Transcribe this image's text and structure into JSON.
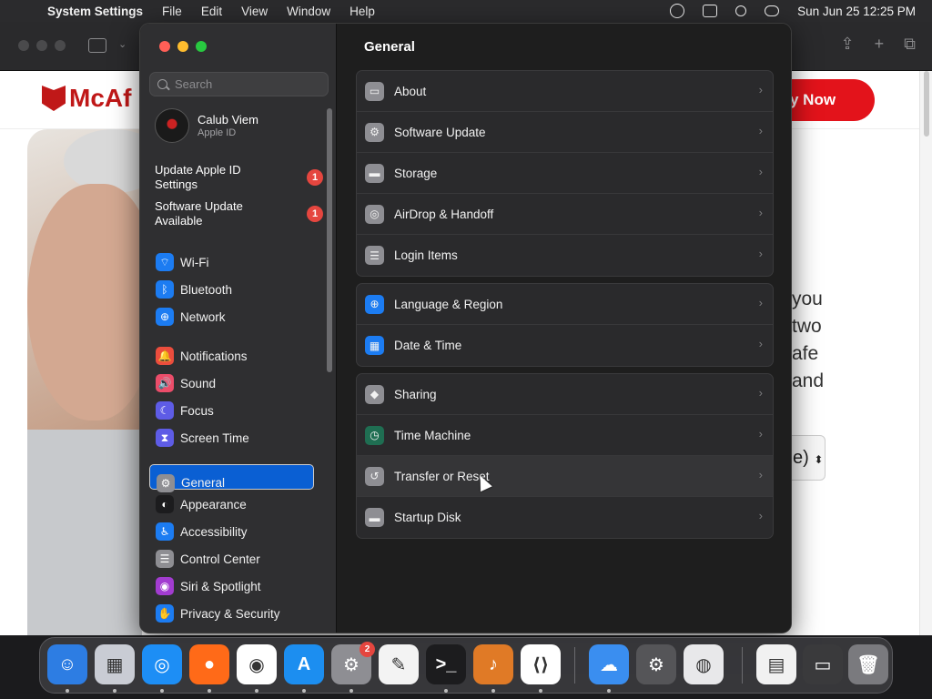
{
  "menubar": {
    "app": "System Settings",
    "menus": [
      "File",
      "Edit",
      "View",
      "Window",
      "Help"
    ],
    "clock": "Sun Jun 25  12:25 PM",
    "status_icons": [
      "screen-time-icon",
      "screen-mirroring-icon",
      "spotlight-icon",
      "control-center-icon"
    ]
  },
  "browser": {
    "logo": "McAf",
    "buy_button": "y Now",
    "text_lines": [
      "you",
      "two",
      "afe",
      "and"
    ],
    "select_value": "e)"
  },
  "sidebar": {
    "search_placeholder": "Search",
    "user_name": "Calub Viem",
    "user_sub": "Apple ID",
    "notices": [
      {
        "label_line1": "Update Apple ID",
        "label_line2": "Settings",
        "badge": "1"
      },
      {
        "label_line1": "Software Update",
        "label_line2": "Available",
        "badge": "1"
      }
    ],
    "items": [
      {
        "label": "Wi-Fi",
        "icon": "wifi-icon",
        "color": "#1c7cf2"
      },
      {
        "label": "Bluetooth",
        "icon": "bluetooth-icon",
        "color": "#1c7cf2"
      },
      {
        "label": "Network",
        "icon": "globe-icon",
        "color": "#1c7cf2"
      },
      {
        "label": "Notifications",
        "icon": "bell-icon",
        "color": "#eb4d3d"
      },
      {
        "label": "Sound",
        "icon": "speaker-icon",
        "color": "#eb4d6a"
      },
      {
        "label": "Focus",
        "icon": "moon-icon",
        "color": "#5e5ce6"
      },
      {
        "label": "Screen Time",
        "icon": "hourglass-icon",
        "color": "#5e5ce6"
      },
      {
        "label": "General",
        "icon": "gear-icon",
        "color": "#8e8e93",
        "selected": true
      },
      {
        "label": "Appearance",
        "icon": "appearance-icon",
        "color": "#1c1c1e"
      },
      {
        "label": "Accessibility",
        "icon": "accessibility-icon",
        "color": "#1c7cf2"
      },
      {
        "label": "Control Center",
        "icon": "control-center-icon",
        "color": "#8e8e93"
      },
      {
        "label": "Siri & Spotlight",
        "icon": "siri-icon",
        "color": "#a23cd0"
      },
      {
        "label": "Privacy & Security",
        "icon": "hand-icon",
        "color": "#1c7cf2"
      }
    ]
  },
  "main": {
    "title": "General",
    "groups": [
      [
        {
          "label": "About",
          "icon": "mac-icon",
          "color": "#8e8e93"
        },
        {
          "label": "Software Update",
          "icon": "gear-badge-icon",
          "color": "#8e8e93"
        },
        {
          "label": "Storage",
          "icon": "drive-icon",
          "color": "#8e8e93"
        },
        {
          "label": "AirDrop & Handoff",
          "icon": "airdrop-icon",
          "color": "#8e8e93"
        },
        {
          "label": "Login Items",
          "icon": "list-icon",
          "color": "#8e8e93"
        }
      ],
      [
        {
          "label": "Language & Region",
          "icon": "globe-icon",
          "color": "#1c7cf2"
        },
        {
          "label": "Date & Time",
          "icon": "calendar-clock-icon",
          "color": "#1c7cf2"
        }
      ],
      [
        {
          "label": "Sharing",
          "icon": "sharing-icon",
          "color": "#8e8e93"
        },
        {
          "label": "Time Machine",
          "icon": "time-machine-icon",
          "color": "#1f6e52"
        },
        {
          "label": "Transfer or Reset",
          "icon": "reset-icon",
          "color": "#8e8e93",
          "hover": true
        },
        {
          "label": "Startup Disk",
          "icon": "disk-icon",
          "color": "#8e8e93"
        }
      ]
    ]
  },
  "dock": {
    "apps": [
      {
        "name": "finder-icon",
        "color": "#2d7de3",
        "glyph": "☺"
      },
      {
        "name": "launchpad-icon",
        "color": "#c9ccd4",
        "glyph": "▦"
      },
      {
        "name": "safari-icon",
        "color": "#1d8ef5",
        "glyph": "◎"
      },
      {
        "name": "firefox-icon",
        "color": "#ff6a18",
        "glyph": "●"
      },
      {
        "name": "chrome-icon",
        "color": "#ffffff",
        "glyph": "◉"
      },
      {
        "name": "app-store-icon",
        "color": "#1c8ef0",
        "glyph": "A"
      },
      {
        "name": "system-settings-icon",
        "color": "#8e8e93",
        "glyph": "⚙",
        "badge": "2"
      },
      {
        "name": "textedit-icon",
        "color": "#f3f3f3",
        "glyph": "✎"
      },
      {
        "name": "terminal-icon",
        "color": "#1c1c1e",
        "glyph": ">_"
      },
      {
        "name": "garageband-icon",
        "color": "#e07a26",
        "glyph": "♪"
      },
      {
        "name": "vscode-icon",
        "color": "#ffffff",
        "glyph": "⟨⟩"
      },
      {
        "name": "weather-icon",
        "color": "#3a8ef0",
        "glyph": "☁"
      },
      {
        "name": "utility-gear-icon",
        "color": "#555558",
        "glyph": "⚙"
      },
      {
        "name": "archive-utility-icon",
        "color": "#e8e8ea",
        "glyph": "◍"
      },
      {
        "name": "preview-icon",
        "color": "#f1f1f1",
        "glyph": "▤"
      },
      {
        "name": "screenshot-icon",
        "color": "#3a3a3c",
        "glyph": "▭"
      },
      {
        "name": "trash-icon",
        "color": "#7a7a7e",
        "glyph": "🗑"
      }
    ]
  }
}
